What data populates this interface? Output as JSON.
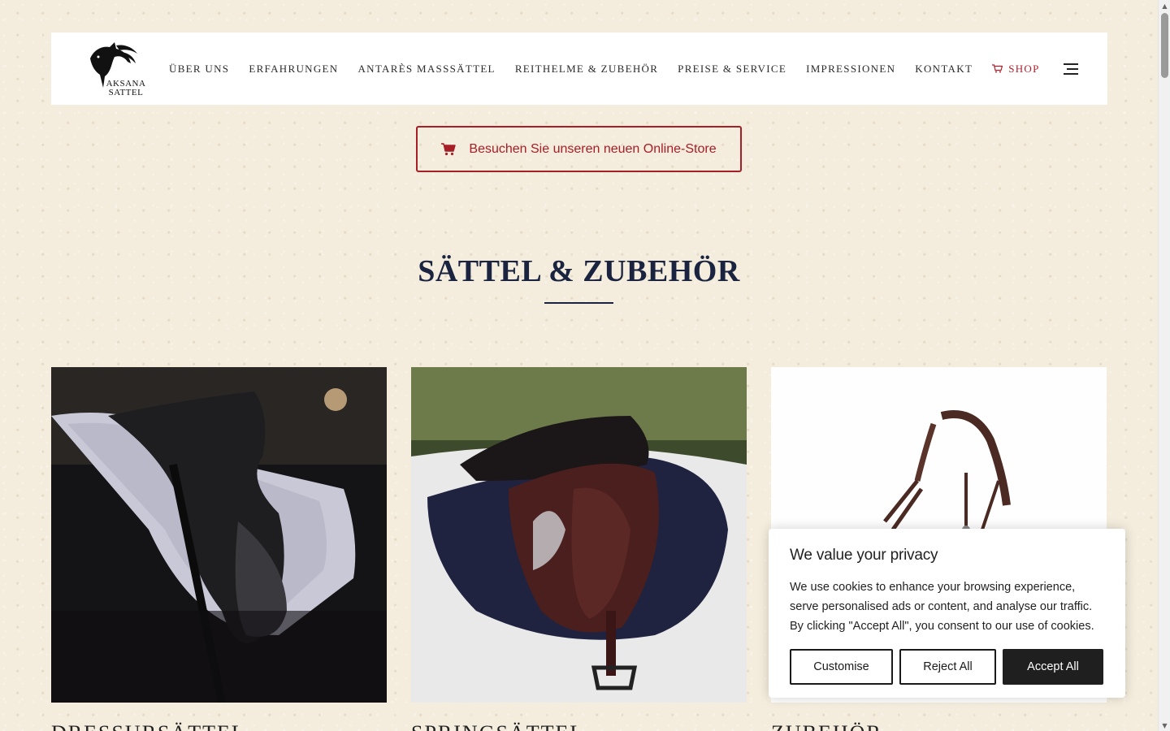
{
  "brand": {
    "logo_line1": "AKSANA",
    "logo_line2": "SATTEL"
  },
  "nav": {
    "items": [
      {
        "label": "ÜBER UNS"
      },
      {
        "label": "ERFAHRUNGEN"
      },
      {
        "label": "ANTARÈS MASSSÄTTEL"
      },
      {
        "label": "REITHELME & ZUBEHÖR"
      },
      {
        "label": "PREISE & SERVICE"
      },
      {
        "label": "IMPRESSIONEN"
      },
      {
        "label": "KONTAKT"
      }
    ],
    "shop_label": "SHOP",
    "shop_icon": "cart-icon",
    "menu_icon": "hamburger-icon"
  },
  "store_button": {
    "label": "Besuchen Sie unseren neuen Online-Store",
    "icon": "cart-icon"
  },
  "section": {
    "title": "SÄTTEL & ZUBEHÖR"
  },
  "cards": [
    {
      "title": "DRESSURSÄTTEL"
    },
    {
      "title": "SPRINGSÄTTEL"
    },
    {
      "title": "ZUBEHÖR"
    }
  ],
  "cookie_banner": {
    "title": "We value your privacy",
    "text": "We use cookies to enhance your browsing experience, serve personalised ads or content, and analyse our traffic. By clicking \"Accept All\", you consent to our use of cookies.",
    "customise_label": "Customise",
    "reject_label": "Reject All",
    "accept_label": "Accept All"
  },
  "colors": {
    "accent_red": "#a61e26",
    "title_navy": "#1a2340",
    "background": "#f4ecdc"
  }
}
